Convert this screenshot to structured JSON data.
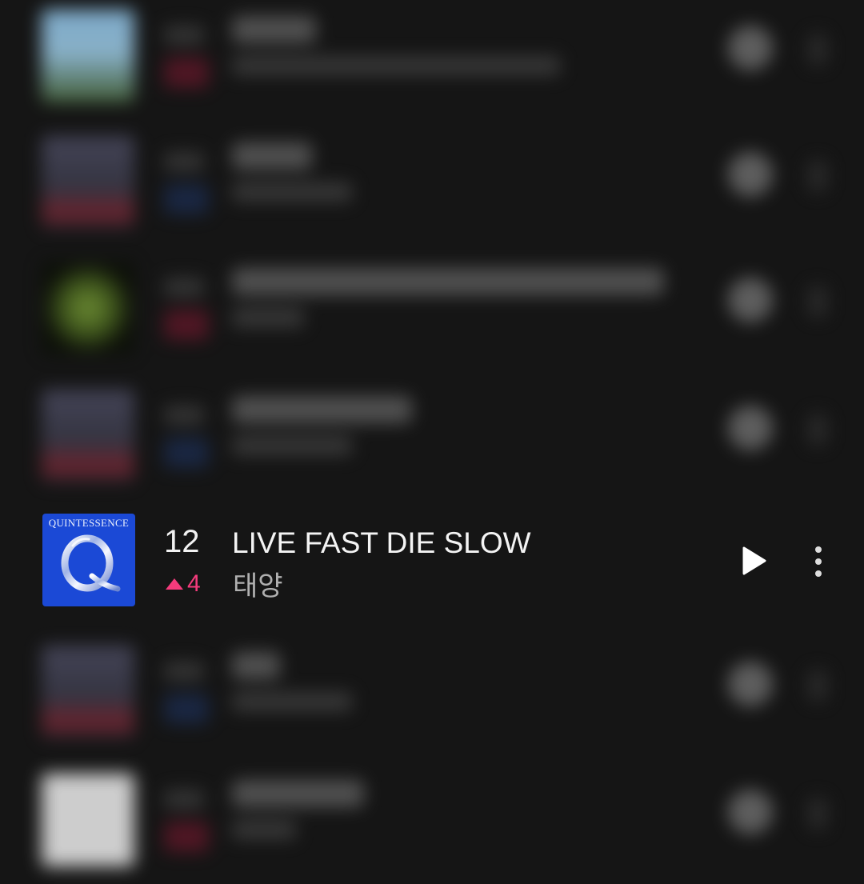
{
  "chart_row": {
    "rank": "12",
    "change": "4",
    "change_direction": "up",
    "title": "LIVE FAST DIE SLOW",
    "artist": "태양",
    "album_cover_title": "QUINTESSENCE",
    "play_icon": "play-icon",
    "more_icon": "more-vertical-icon"
  },
  "colors": {
    "background": "#151515",
    "rank_up": "#f53b7c",
    "album_cover_blue": "#1b49d6",
    "artist_gray": "#b0b0b0"
  }
}
